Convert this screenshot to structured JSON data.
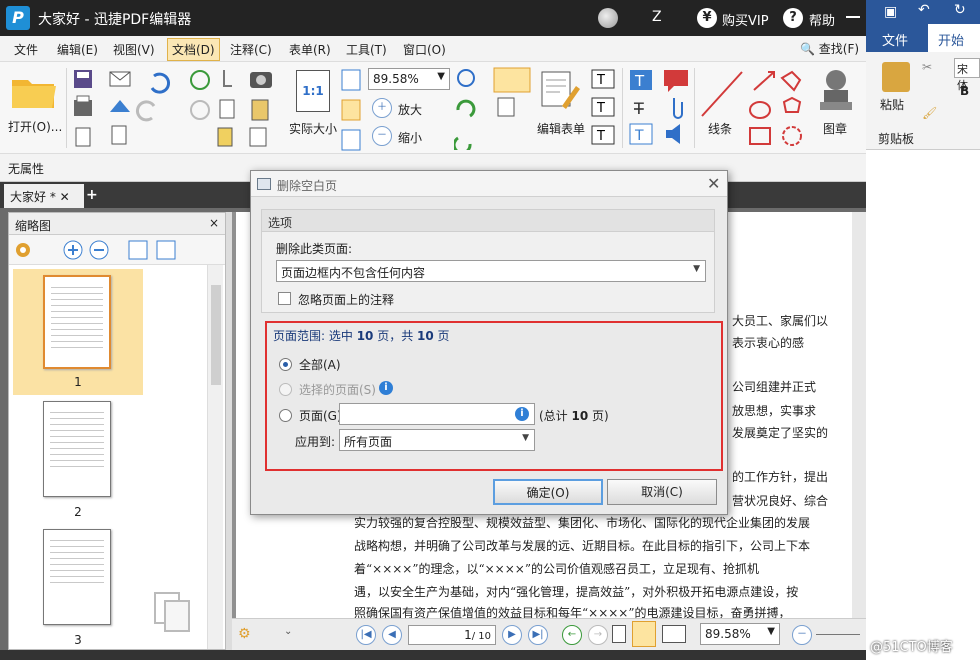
{
  "app": {
    "title": "大家好 - 迅捷PDF编辑器",
    "logo_letter": "P",
    "user_initial": "Z",
    "buy_vip": "购买VIP",
    "help": "帮助",
    "vip_symbol": "¥",
    "help_symbol": "?"
  },
  "menu": {
    "items": [
      "文件",
      "编辑(E)",
      "视图(V)",
      "文档(D)",
      "注释(C)",
      "表单(R)",
      "工具(T)",
      "窗口(O)"
    ],
    "active_index": 3,
    "find": "查找(F)"
  },
  "toolbar": {
    "open": "打开(O)...",
    "actual_size": "实际大小",
    "actual_size_icon": "1:1",
    "zoom": "89.58%",
    "zoom_in": "放大",
    "zoom_out": "缩小",
    "edit_form": "编辑表单",
    "line": "线条",
    "stamp": "图章"
  },
  "properties": {
    "label": "无属性"
  },
  "tab": {
    "name": "大家好 *"
  },
  "thumbnails": {
    "title": "缩略图",
    "pages": [
      "1",
      "2",
      "3"
    ],
    "selected_index": 0
  },
  "document": {
    "lines": [
      "大员工、家属们以",
      "表示衷心的感",
      "公司组建并正式",
      "放思想，实事求",
      "发展奠定了坚实的",
      "的工作方针，提出",
      "营状况良好、综合",
      "实力较强的复合控股型、规模效益型、集团化、市场化、国际化的现代企业集团的发展",
      "战略构想，并明确了公司改革与发展的远、近期目标。在此目标的指引下，公司上下本",
      "着“××××”的理念，以“××××”的公司价值观感召员工，立足现有、抢抓机",
      "遇，以安全生产为基础，对内“强化管理，提高效益”，对外积极开拓电源点建设，按",
      "照确保国有资产保值增值的效益目标和每年“××××”的电源建设目标，奋勇拼搏，"
    ]
  },
  "nav": {
    "page_value": "1",
    "page_total": "/ 10",
    "zoom": "89.58%"
  },
  "word": {
    "tab_file": "文件",
    "tab_home": "开始",
    "paste": "粘贴",
    "clipboard": "剪贴板",
    "font": "宋体",
    "bold": "B"
  },
  "dialog": {
    "title": "删除空白页",
    "options_header": "选项",
    "delete_type_label": "删除此类页面:",
    "delete_type_value": "页面边框内不包含任何内容",
    "ignore_annotations": "忽略页面上的注释",
    "range_prefix": "页面范围: 选中 ",
    "range_selected": "10",
    "range_mid": " 页，共 ",
    "range_total": "10",
    "range_suffix": " 页",
    "radio_all": "全部(A)",
    "radio_selected": "选择的页面(S)",
    "radio_pages": "页面(G)",
    "pages_input": "",
    "total_prefix": "(总计 ",
    "total_count": "10",
    "total_suffix": " 页)",
    "apply_to_label": "应用到:",
    "apply_to_value": "所有页面",
    "ok": "确定(O)",
    "cancel": "取消(C)"
  },
  "watermark": "@51CTO博客",
  "colors": {
    "accent_red": "#e03030",
    "word_blue": "#2b579a",
    "menu_active": "#fbe7b5"
  }
}
